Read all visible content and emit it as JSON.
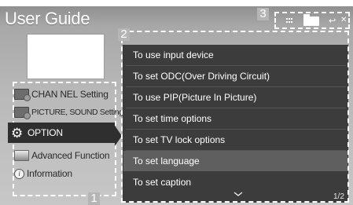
{
  "header": {
    "title": "User Guide"
  },
  "badges": {
    "sidebar": "1",
    "menu": "2",
    "toolbar": "3"
  },
  "sidebar": {
    "items": [
      {
        "label": "CHAN NEL Setting",
        "icon": "channel-icon"
      },
      {
        "label": "PICTURE, SOUND Setting",
        "icon": "picture-sound-icon"
      },
      {
        "label": "OPTION",
        "icon": "gear-icon",
        "selected": true
      },
      {
        "label": "Advanced Function",
        "icon": "advanced-function-icon"
      },
      {
        "label": "Information",
        "icon": "info-icon"
      }
    ]
  },
  "menu": {
    "items": [
      {
        "label": "To use input device"
      },
      {
        "label": "To set ODC(Over Driving Circuit)"
      },
      {
        "label": "To use PIP(Picture In Picture)"
      },
      {
        "label": "To set time options"
      },
      {
        "label": "To set TV lock options"
      },
      {
        "label": "To set language",
        "selected": true
      },
      {
        "label": "To set caption"
      }
    ],
    "page_indicator": "1/2"
  },
  "toolbar": {
    "icons": [
      "grid-view-icon",
      "folder-icon",
      "return-icon",
      "close-icon"
    ]
  },
  "colors": {
    "panel_bg": "#3c3c3c",
    "selected_sidebar_bg": "#2f2f2f",
    "selected_menu_bg": "#5f5f5f",
    "badge_bg": "#b5b5b5"
  }
}
